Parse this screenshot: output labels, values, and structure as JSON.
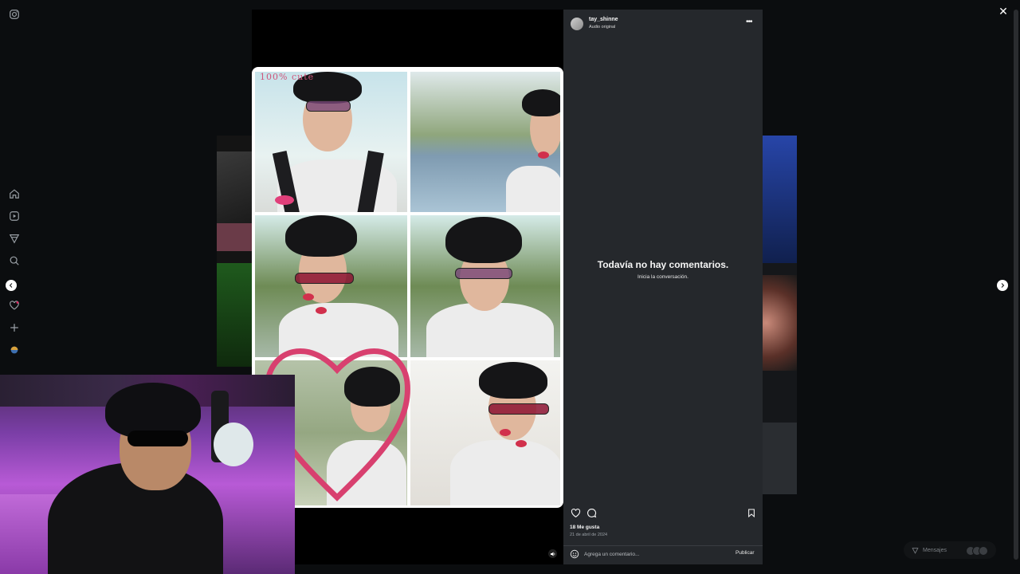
{
  "post": {
    "username": "tay_shinne",
    "audio": "Audio original",
    "empty_title": "Todavía no hay comentarios.",
    "empty_subtitle": "Inicia la conversación.",
    "likes": "18 Me gusta",
    "date": "21 de abril de 2024",
    "comment_placeholder": "Agrega un comentario...",
    "publish_label": "Publicar",
    "sticker_text": "100% cute"
  },
  "floating": {
    "messages_label": "Mensajes"
  },
  "icons": {
    "left_rail": [
      "instagram-icon",
      "home-icon",
      "reels-icon",
      "explore-icon",
      "search-icon",
      "heart-icon",
      "create-icon",
      "profile-icon"
    ],
    "actions": [
      "heart-icon",
      "comment-icon",
      "bookmark-icon"
    ]
  },
  "colors": {
    "page_bg": "#0b0d0f",
    "comments_bg": "#25282c",
    "accent_pink": "#d0557a"
  }
}
